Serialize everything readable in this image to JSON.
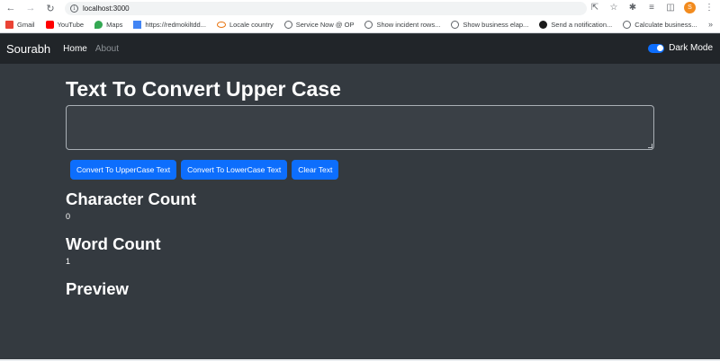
{
  "browser": {
    "url": "localhost:3000",
    "profile_initial": "S",
    "bookmarks": [
      {
        "label": "Gmail",
        "color": "#ea4335",
        "icon": "gmail-icon"
      },
      {
        "label": "YouTube",
        "color": "#ff0000",
        "icon": "youtube-icon"
      },
      {
        "label": "Maps",
        "color": "#34a853",
        "icon": "maps-icon"
      },
      {
        "label": "https://redmokiltdd...",
        "color": "#4285f4",
        "icon": "windows-icon"
      },
      {
        "label": "Locale country",
        "color": "#e8710a",
        "icon": "oval-icon"
      },
      {
        "label": "Service Now @ OP",
        "color": "#5f6368",
        "icon": "servicenow-icon"
      },
      {
        "label": "Show incident rows...",
        "color": "#5f6368",
        "icon": "servicenow-icon"
      },
      {
        "label": "Show business elap...",
        "color": "#5f6368",
        "icon": "servicenow-icon"
      },
      {
        "label": "Send a notification...",
        "color": "#1a1a1a",
        "icon": "globe-icon"
      },
      {
        "label": "Calculate business...",
        "color": "#5f6368",
        "icon": "servicenow-icon"
      }
    ]
  },
  "navbar": {
    "brand": "Sourabh",
    "links": [
      {
        "label": "Home",
        "active": true
      },
      {
        "label": "About",
        "active": false
      }
    ],
    "toggle_label": "Dark Mode"
  },
  "main": {
    "heading": "Text To Convert Upper Case",
    "textarea_value": "",
    "buttons": [
      {
        "label": "Convert To UpperCase Text"
      },
      {
        "label": "Convert To LowerCase Text"
      },
      {
        "label": "Clear Text"
      }
    ],
    "char_count_heading": "Character Count",
    "char_count_value": "0",
    "word_count_heading": "Word Count",
    "word_count_value": "1",
    "preview_heading": "Preview"
  },
  "colors": {
    "page_bg": "#343a40",
    "navbar_bg": "#212529",
    "button_bg": "#0d6efd"
  }
}
